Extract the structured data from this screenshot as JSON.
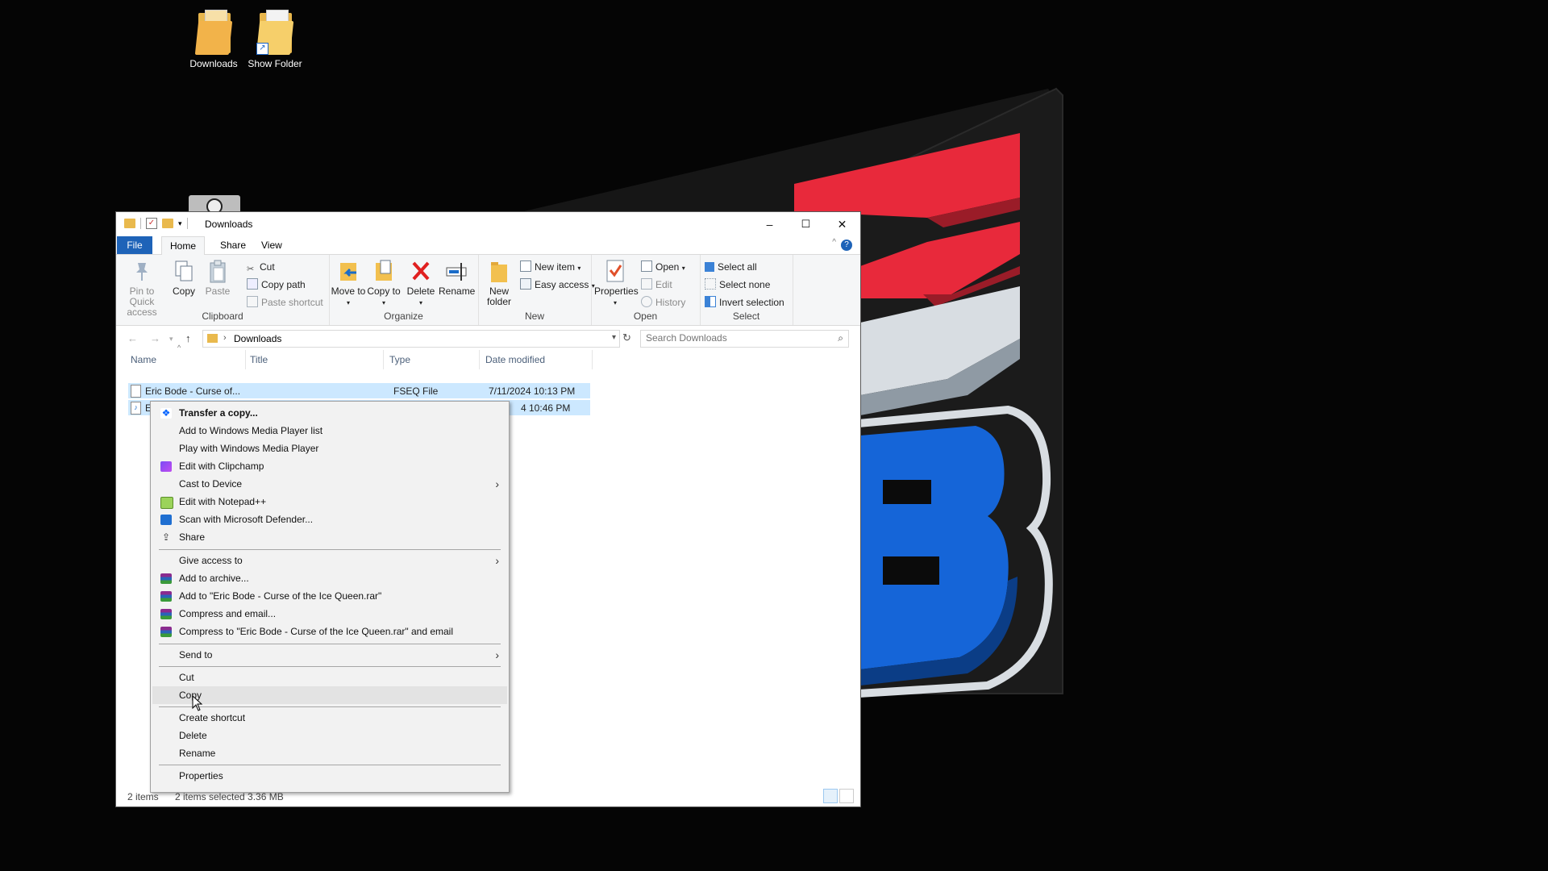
{
  "desktop": {
    "icons": [
      {
        "label": "Downloads"
      },
      {
        "label": "Show Folder"
      }
    ]
  },
  "window": {
    "title": "Downloads",
    "controls": {
      "minimize": "–",
      "maximize": "☐",
      "close": "✕"
    },
    "tabs": {
      "file": "File",
      "home": "Home",
      "share": "Share",
      "view": "View"
    },
    "ribbon": {
      "clipboard": {
        "label": "Clipboard",
        "pin": "Pin to Quick access",
        "copy": "Copy",
        "paste": "Paste",
        "cut": "Cut",
        "copy_path": "Copy path",
        "paste_shortcut": "Paste shortcut"
      },
      "organize": {
        "label": "Organize",
        "move_to": "Move to",
        "copy_to": "Copy to",
        "delete": "Delete",
        "rename": "Rename"
      },
      "new": {
        "label": "New",
        "new_folder": "New folder",
        "new_item": "New item",
        "easy_access": "Easy access"
      },
      "open": {
        "label": "Open",
        "properties": "Properties",
        "open": "Open",
        "edit": "Edit",
        "history": "History"
      },
      "select": {
        "label": "Select",
        "select_all": "Select all",
        "select_none": "Select none",
        "invert": "Invert selection"
      }
    },
    "address": {
      "path": "Downloads",
      "search_placeholder": "Search Downloads"
    },
    "columns": {
      "name": "Name",
      "title": "Title",
      "type": "Type",
      "date": "Date modified"
    },
    "rows": [
      {
        "name": "Eric Bode - Curse of...",
        "type": "FSEQ File",
        "date": "7/11/2024 10:13 PM"
      },
      {
        "name": "E",
        "type": "",
        "date": "4 10:46 PM"
      }
    ],
    "status": {
      "items": "2 items",
      "selected": "2 items selected  3.36 MB"
    }
  },
  "context_menu": {
    "items": [
      {
        "label": "Transfer a copy..."
      },
      {
        "label": "Add to Windows Media Player list"
      },
      {
        "label": "Play with Windows Media Player"
      },
      {
        "label": "Edit with Clipchamp"
      },
      {
        "label": "Cast to Device"
      },
      {
        "label": "Edit with Notepad++"
      },
      {
        "label": "Scan with Microsoft Defender..."
      },
      {
        "label": "Share"
      },
      {
        "label": "Give access to"
      },
      {
        "label": "Add to archive..."
      },
      {
        "label": "Add to \"Eric Bode - Curse of the Ice Queen.rar\""
      },
      {
        "label": "Compress and email..."
      },
      {
        "label": "Compress to \"Eric Bode - Curse of the Ice Queen.rar\" and email"
      },
      {
        "label": "Send to"
      },
      {
        "label": "Cut"
      },
      {
        "label": "Copy"
      },
      {
        "label": "Create shortcut"
      },
      {
        "label": "Delete"
      },
      {
        "label": "Rename"
      },
      {
        "label": "Properties"
      }
    ]
  },
  "colors": {
    "file_tab": "#1e63b8",
    "selection": "#cce8ff",
    "logo_red": "#e8293b",
    "logo_blue": "#1565d8"
  }
}
